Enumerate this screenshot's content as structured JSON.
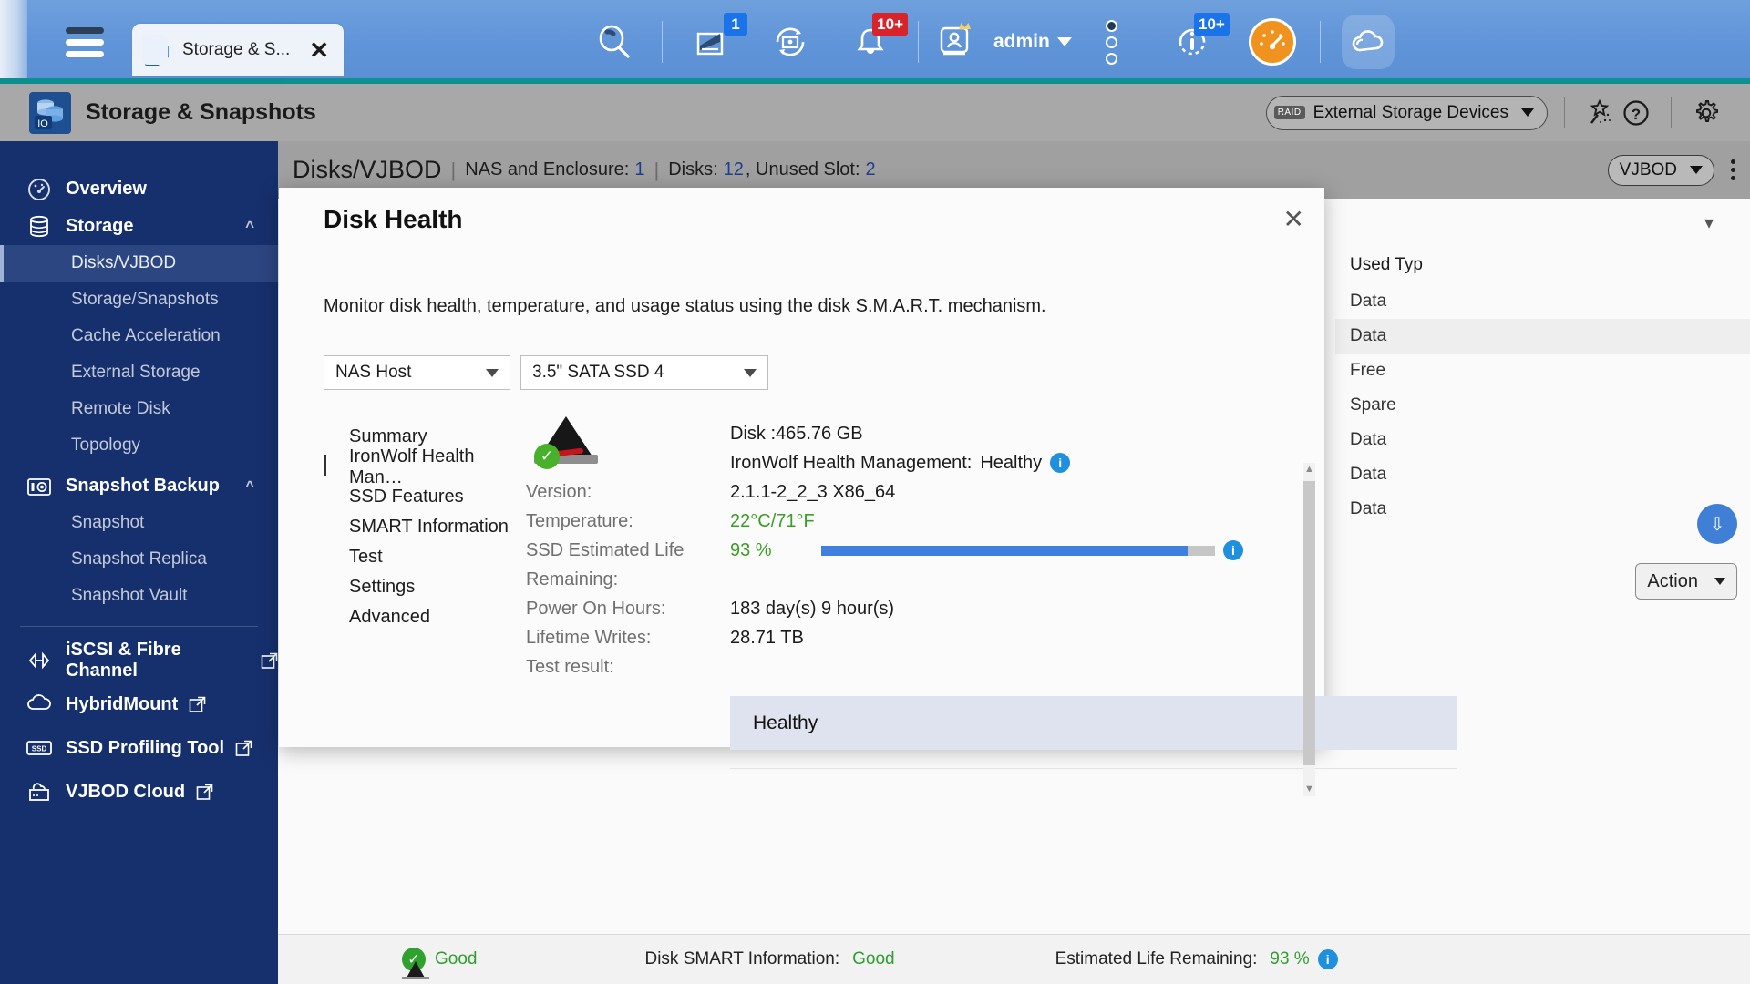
{
  "topbar": {
    "tab": {
      "label": "Storage & S...",
      "icon": "storage-app-icon",
      "close": "✕"
    },
    "menu_icon": "hamburger-menu-icon",
    "icons": [
      {
        "name": "search-icon",
        "badge": null
      },
      {
        "name": "background-tasks-icon",
        "badge": "1",
        "badge_color": "#1a73e8"
      },
      {
        "name": "resource-monitor-icon",
        "badge": null
      },
      {
        "name": "notifications-bell-icon",
        "badge": "10+",
        "badge_color": "#d8232a"
      },
      {
        "name": "user-admin-icon",
        "badge": null
      },
      {
        "name": "more-options-icon",
        "badge": null
      },
      {
        "name": "system-info-icon",
        "badge": "10+",
        "badge_color": "#1a73e8"
      },
      {
        "name": "dashboard-gauge-icon",
        "badge": null
      },
      {
        "name": "mycloud-icon",
        "badge": null
      }
    ],
    "admin_label": "admin"
  },
  "appheader": {
    "title": "Storage & Snapshots",
    "storage_selector": {
      "tag": "RAID",
      "label": "External Storage Devices"
    },
    "icons": [
      "magic-wand-icon",
      "help-icon",
      "settings-gear-icon"
    ]
  },
  "sidebar": {
    "groups": [
      {
        "label": "Overview",
        "icon": "overview-gauge-icon",
        "type": "top"
      },
      {
        "label": "Storage",
        "icon": "storage-stack-icon",
        "type": "top",
        "collapse": "chevron-up-icon"
      },
      {
        "label": "Disks/VJBOD",
        "type": "sub",
        "active": true
      },
      {
        "label": "Storage/Snapshots",
        "type": "sub",
        "active": false
      },
      {
        "label": "Cache Acceleration",
        "type": "sub",
        "active": false
      },
      {
        "label": "External Storage",
        "type": "sub",
        "active": false
      },
      {
        "label": "Remote Disk",
        "type": "sub",
        "active": false
      },
      {
        "label": "Topology",
        "type": "sub",
        "active": false
      },
      {
        "label": "Snapshot Backup",
        "icon": "snapshot-camera-icon",
        "type": "top",
        "collapse": "chevron-up-icon"
      },
      {
        "label": "Snapshot",
        "type": "sub",
        "active": false
      },
      {
        "label": "Snapshot Replica",
        "type": "sub",
        "active": false
      },
      {
        "label": "Snapshot Vault",
        "type": "sub",
        "active": false
      }
    ],
    "external": [
      {
        "label": "iSCSI & Fibre Channel",
        "icon": "iscsi-icon"
      },
      {
        "label": "HybridMount",
        "icon": "hybridmount-icon"
      },
      {
        "label": "SSD Profiling Tool",
        "icon": "ssd-profiling-icon"
      },
      {
        "label": "VJBOD Cloud",
        "icon": "vjbod-cloud-icon"
      }
    ]
  },
  "breadcrumb": {
    "title": "Disks/VJBOD",
    "stats": [
      {
        "label": "NAS and Enclosure:",
        "value": "1"
      },
      {
        "label": "Disks:",
        "value": "12"
      },
      {
        "label": ", Unused Slot:",
        "value": "2"
      }
    ],
    "vjbod_selector": "VJBOD",
    "kebab": "more-actions-icon"
  },
  "background_table": {
    "column_header": "Used Typ",
    "rows": [
      "Data",
      "Data",
      "Free",
      "Spare",
      "Data",
      "Data",
      "Data"
    ],
    "action_button": "Action",
    "expand_icon": "chevron-double-down-icon"
  },
  "statusbar": {
    "health_label": "Good",
    "smart_label": "Disk SMART Information:",
    "smart_value": "Good",
    "life_label": "Estimated Life Remaining:",
    "life_value": "93 %"
  },
  "dialog": {
    "title": "Disk Health",
    "close": "✕",
    "description": "Monitor disk health, temperature, and usage status using the disk S.M.A.R.T. mechanism.",
    "selectors": [
      {
        "name": "host-select",
        "value": "NAS Host"
      },
      {
        "name": "disk-select",
        "value": "3.5\" SATA SSD 4"
      }
    ],
    "tabs": [
      {
        "label": "Summary",
        "active": false
      },
      {
        "label": "IronWolf Health Man…",
        "active": true
      },
      {
        "label": "SSD Features",
        "active": false
      },
      {
        "label": "SMART Information",
        "active": false
      },
      {
        "label": "Test",
        "active": false
      },
      {
        "label": "Settings",
        "active": false
      },
      {
        "label": "Advanced",
        "active": false
      }
    ],
    "disk_capacity": "Disk :465.76 GB",
    "ihm_label": "IronWolf Health Management:",
    "ihm_value": "Healthy",
    "fields": [
      {
        "key": "Version:",
        "value": "2.1.1-2_2_3 X86_64",
        "green": false
      },
      {
        "key": "Temperature:",
        "value": "22°C/71°F",
        "green": true
      }
    ],
    "ssd_life": {
      "key": "SSD Estimated Life",
      "key2": "Remaining:",
      "value": "93 %",
      "percent": 93
    },
    "fields2": [
      {
        "key": "Power On Hours:",
        "value": "183 day(s) 9 hour(s)"
      },
      {
        "key": "Lifetime Writes:",
        "value": "28.71 TB"
      },
      {
        "key": "Test result:",
        "value": ""
      }
    ],
    "test_result": "Healthy",
    "disk_icon": "ironwolf-seagate-icon",
    "status_icon": "green-check-icon",
    "info_icon": "info-icon"
  },
  "colors": {
    "accent_blue": "#3f7fe0",
    "green": "#3b9e28",
    "sidebar": "#16306e",
    "topbar": "#5f94d8",
    "teal": "#0d8f8f"
  }
}
